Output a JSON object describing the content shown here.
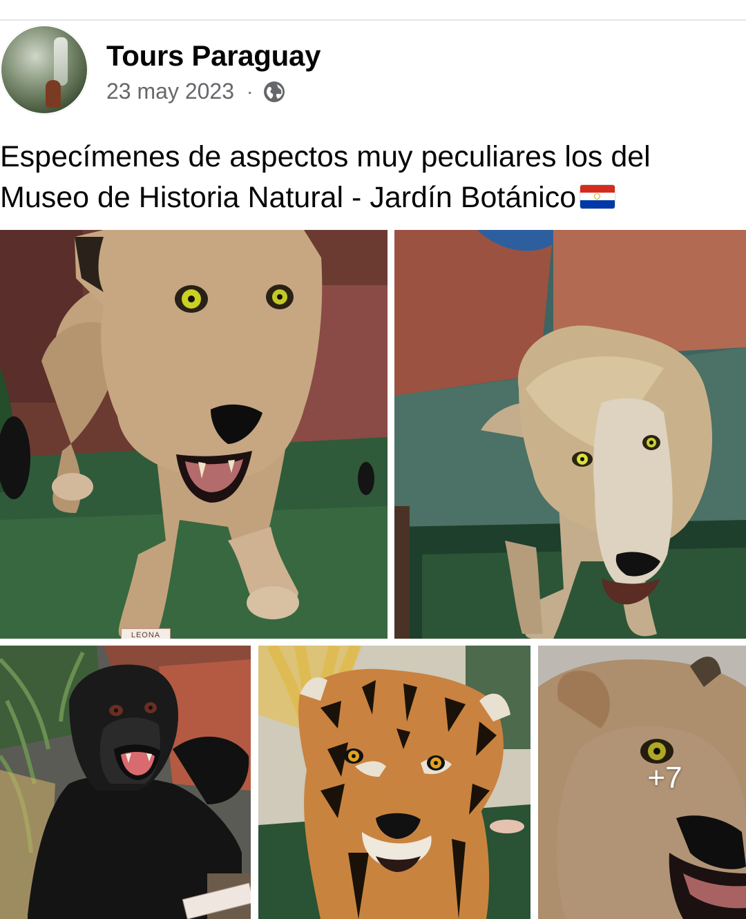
{
  "post": {
    "author": "Tours Paraguay",
    "date": "23 may 2023",
    "separator": "·",
    "privacy_icon": "globe-icon",
    "caption": "Especímenes de aspectos muy peculiares los del Museo de Historia Natural - Jardín Botánico",
    "caption_emoji": "flag-paraguay-icon"
  },
  "photos": {
    "lioness_plaque": "LEONA",
    "more_count": "+7"
  },
  "colors": {
    "text_primary": "#050505",
    "text_secondary": "#65676b",
    "divider": "#e4e6eb"
  }
}
